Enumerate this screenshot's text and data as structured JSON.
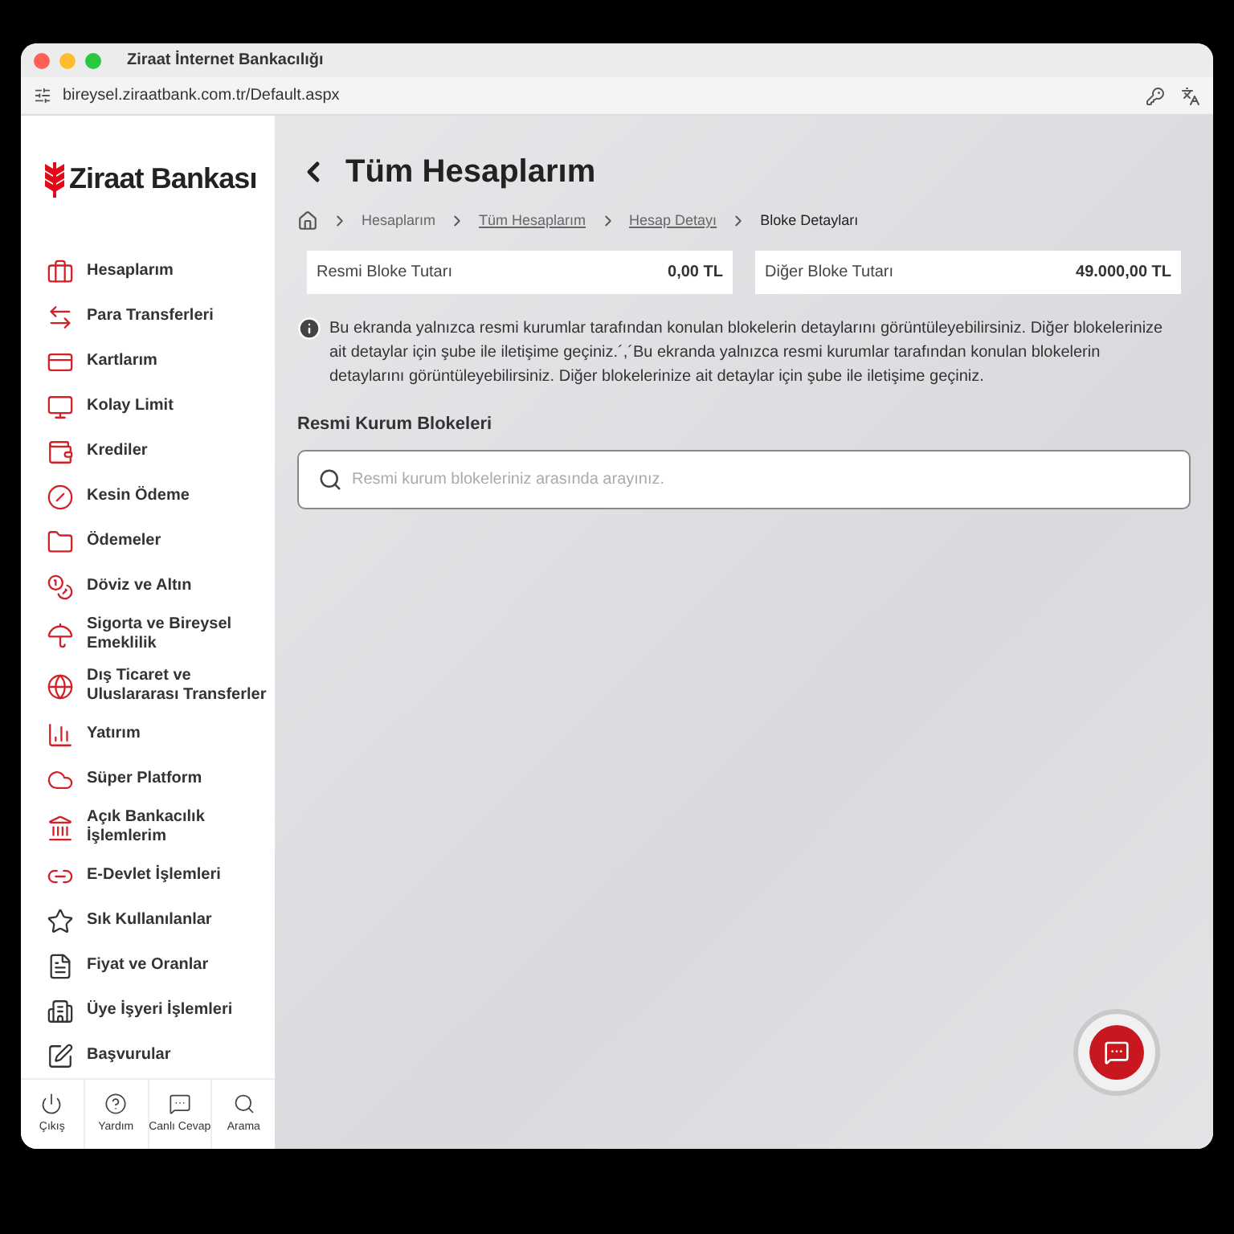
{
  "window": {
    "title": "Ziraat İnternet Bankacılığı",
    "url": "bireysel.ziraatbank.com.tr/Default.aspx"
  },
  "sidebar": {
    "logo": "Ziraat Bankası",
    "items": [
      {
        "label": "Hesaplarım"
      },
      {
        "label": "Para Transferleri"
      },
      {
        "label": "Kartlarım"
      },
      {
        "label": "Kolay Limit"
      },
      {
        "label": "Krediler"
      },
      {
        "label": "Kesin Ödeme"
      },
      {
        "label": "Ödemeler"
      },
      {
        "label": "Döviz ve Altın"
      },
      {
        "label": "Sigorta ve Bireysel Emeklilik"
      },
      {
        "label": "Dış Ticaret ve Uluslararası Transferler"
      },
      {
        "label": "Yatırım"
      },
      {
        "label": "Süper Platform"
      },
      {
        "label": "Açık Bankacılık İşlemlerim"
      },
      {
        "label": "E-Devlet İşlemleri"
      },
      {
        "label": "Sık Kullanılanlar"
      },
      {
        "label": "Fiyat ve Oranlar"
      },
      {
        "label": "Üye İşyeri İşlemleri"
      },
      {
        "label": "Başvurular"
      }
    ],
    "bottom_buttons": [
      {
        "label": "Çıkış"
      },
      {
        "label": "Yardım"
      },
      {
        "label": "Canlı Cevap"
      },
      {
        "label": "Arama"
      }
    ]
  },
  "page": {
    "title": "Tüm Hesaplarım",
    "breadcrumb": [
      {
        "label": "Hesaplarım",
        "kind": "plain"
      },
      {
        "label": "Tüm Hesaplarım",
        "kind": "link"
      },
      {
        "label": "Hesap Detayı",
        "kind": "link"
      },
      {
        "label": "Bloke Detayları",
        "kind": "current"
      }
    ],
    "totals": [
      {
        "label": "Resmi Bloke Tutarı",
        "value": "0,00 TL"
      },
      {
        "label": "Diğer Bloke Tutarı",
        "value": "49.000,00 TL"
      }
    ],
    "info": "Bu ekranda yalnızca resmi kurumlar tarafından konulan blokelerin detaylarını görüntüleyebilirsiniz. Diğer blokelerinize ait detaylar için şube ile iletişime geçiniz.´,´Bu ekranda yalnızca resmi kurumlar tarafından konulan blokelerin detaylarını görüntüleyebilirsiniz. Diğer blokelerinize ait detaylar için şube ile iletişime geçiniz.",
    "section_title": "Resmi Kurum Blokeleri",
    "search": {
      "placeholder": "Resmi kurum blokeleriniz arasında arayınız."
    }
  }
}
